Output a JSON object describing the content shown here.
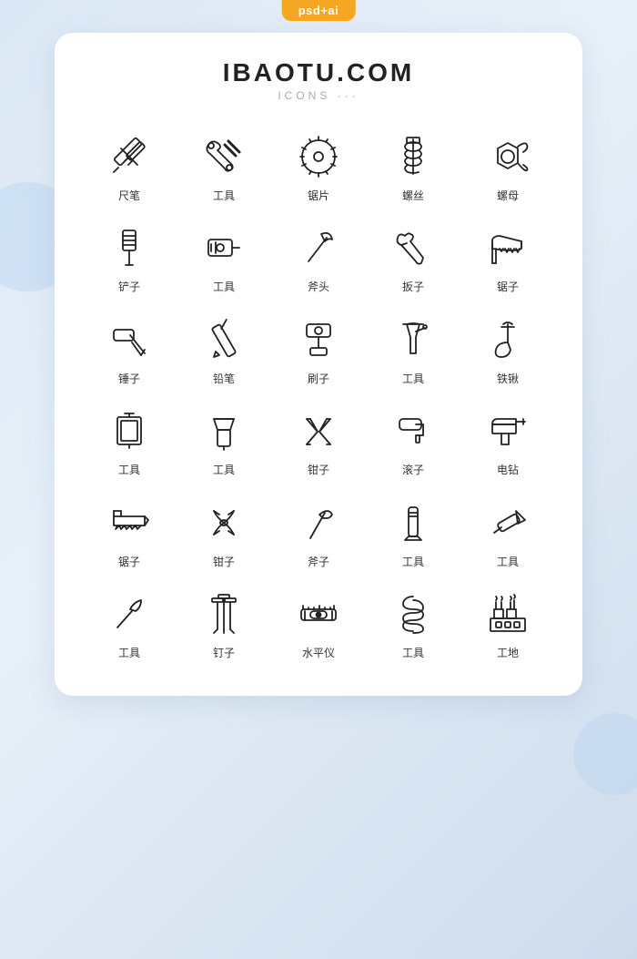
{
  "badge": "psd+ai",
  "header": {
    "title": "IBAOTU.COM",
    "subtitle": "ICONS ···"
  },
  "icons": [
    {
      "id": "chi-bi",
      "label": "尺笔",
      "symbol": "ruler-pen"
    },
    {
      "id": "gong-ju-1",
      "label": "工具",
      "symbol": "wrench"
    },
    {
      "id": "ju-pian",
      "label": "锯片",
      "symbol": "saw-blade"
    },
    {
      "id": "luo-si",
      "label": "螺丝",
      "symbol": "screw"
    },
    {
      "id": "luo-mu",
      "label": "螺母",
      "symbol": "nut"
    },
    {
      "id": "chan-zi",
      "label": "铲子",
      "symbol": "spatula"
    },
    {
      "id": "gong-ju-2",
      "label": "工具",
      "symbol": "ruler-box"
    },
    {
      "id": "fu-tou-1",
      "label": "斧头",
      "symbol": "axe"
    },
    {
      "id": "ban-zi",
      "label": "扳子",
      "symbol": "pliers-grip"
    },
    {
      "id": "ju-zi",
      "label": "锯子",
      "symbol": "handsaw"
    },
    {
      "id": "chui-zi",
      "label": "锤子",
      "symbol": "hammer"
    },
    {
      "id": "qian-bi",
      "label": "铅笔",
      "symbol": "pencil"
    },
    {
      "id": "shua-zi",
      "label": "刷子",
      "symbol": "paint-roller-brush"
    },
    {
      "id": "gong-ju-3",
      "label": "工具",
      "symbol": "funnel"
    },
    {
      "id": "tie-qiao",
      "label": "铁锹",
      "symbol": "shovel"
    },
    {
      "id": "gong-ju-4",
      "label": "工具",
      "symbol": "c-clamp"
    },
    {
      "id": "gong-ju-5",
      "label": "工具",
      "symbol": "scraper"
    },
    {
      "id": "qian-zi-1",
      "label": "钳子",
      "symbol": "pliers"
    },
    {
      "id": "gun-zi",
      "label": "滚子",
      "symbol": "paint-roller"
    },
    {
      "id": "dian-zuan",
      "label": "电钻",
      "symbol": "drill"
    },
    {
      "id": "ju-zi-2",
      "label": "锯子",
      "symbol": "saw"
    },
    {
      "id": "qian-zi-2",
      "label": "钳子",
      "symbol": "wire-cutters"
    },
    {
      "id": "fu-tou-2",
      "label": "斧子",
      "symbol": "axe2"
    },
    {
      "id": "gong-ju-6",
      "label": "工具",
      "symbol": "chisel"
    },
    {
      "id": "gong-ju-7",
      "label": "工具",
      "symbol": "knife"
    },
    {
      "id": "gong-ju-8",
      "label": "工具",
      "symbol": "pick"
    },
    {
      "id": "ding-zi",
      "label": "钉子",
      "symbol": "nails"
    },
    {
      "id": "shui-ping-yi",
      "label": "水平仪",
      "symbol": "level"
    },
    {
      "id": "gong-ju-9",
      "label": "工具",
      "symbol": "coil"
    },
    {
      "id": "gong-di",
      "label": "工地",
      "symbol": "factory"
    }
  ]
}
